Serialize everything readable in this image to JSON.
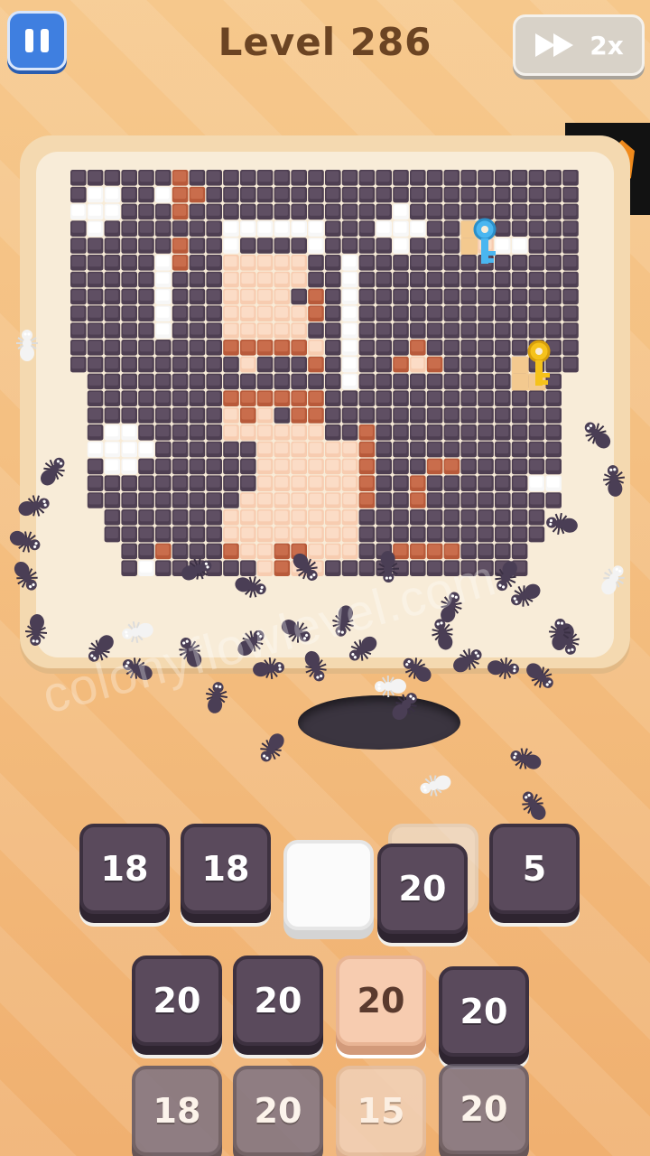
{
  "header": {
    "title": "Level 286",
    "speed_label": "2x"
  },
  "watermark": "colonyflowlevel.com",
  "icons": {
    "pause": "pause-icon",
    "speed": "fast-forward-icon",
    "logo": "tiger-logo",
    "key_blue": "key-icon",
    "key_yellow": "key-icon"
  },
  "colors": {
    "dark_tile": "#4e3f52",
    "peach_tile": "#f7ccb0",
    "rust_tile": "#b85a3a",
    "white_tile": "#ffffff",
    "accent_blue": "#3f7fe0"
  },
  "slots": [
    {
      "value": "18",
      "style": "dark"
    },
    {
      "value": "18",
      "style": "dark"
    },
    {
      "value": "",
      "style": "white"
    },
    {
      "value": "20",
      "style": "dark"
    },
    {
      "value": "5",
      "style": "dark"
    }
  ],
  "queue": [
    {
      "value": "20",
      "style": "dark"
    },
    {
      "value": "20",
      "style": "dark"
    },
    {
      "value": "20",
      "style": "peach"
    },
    {
      "value": "20",
      "style": "dark"
    },
    {
      "value": "18",
      "style": "dim"
    },
    {
      "value": "20",
      "style": "dim"
    },
    {
      "value": "15",
      "style": "peachdim"
    },
    {
      "value": "20",
      "style": "dim"
    }
  ]
}
